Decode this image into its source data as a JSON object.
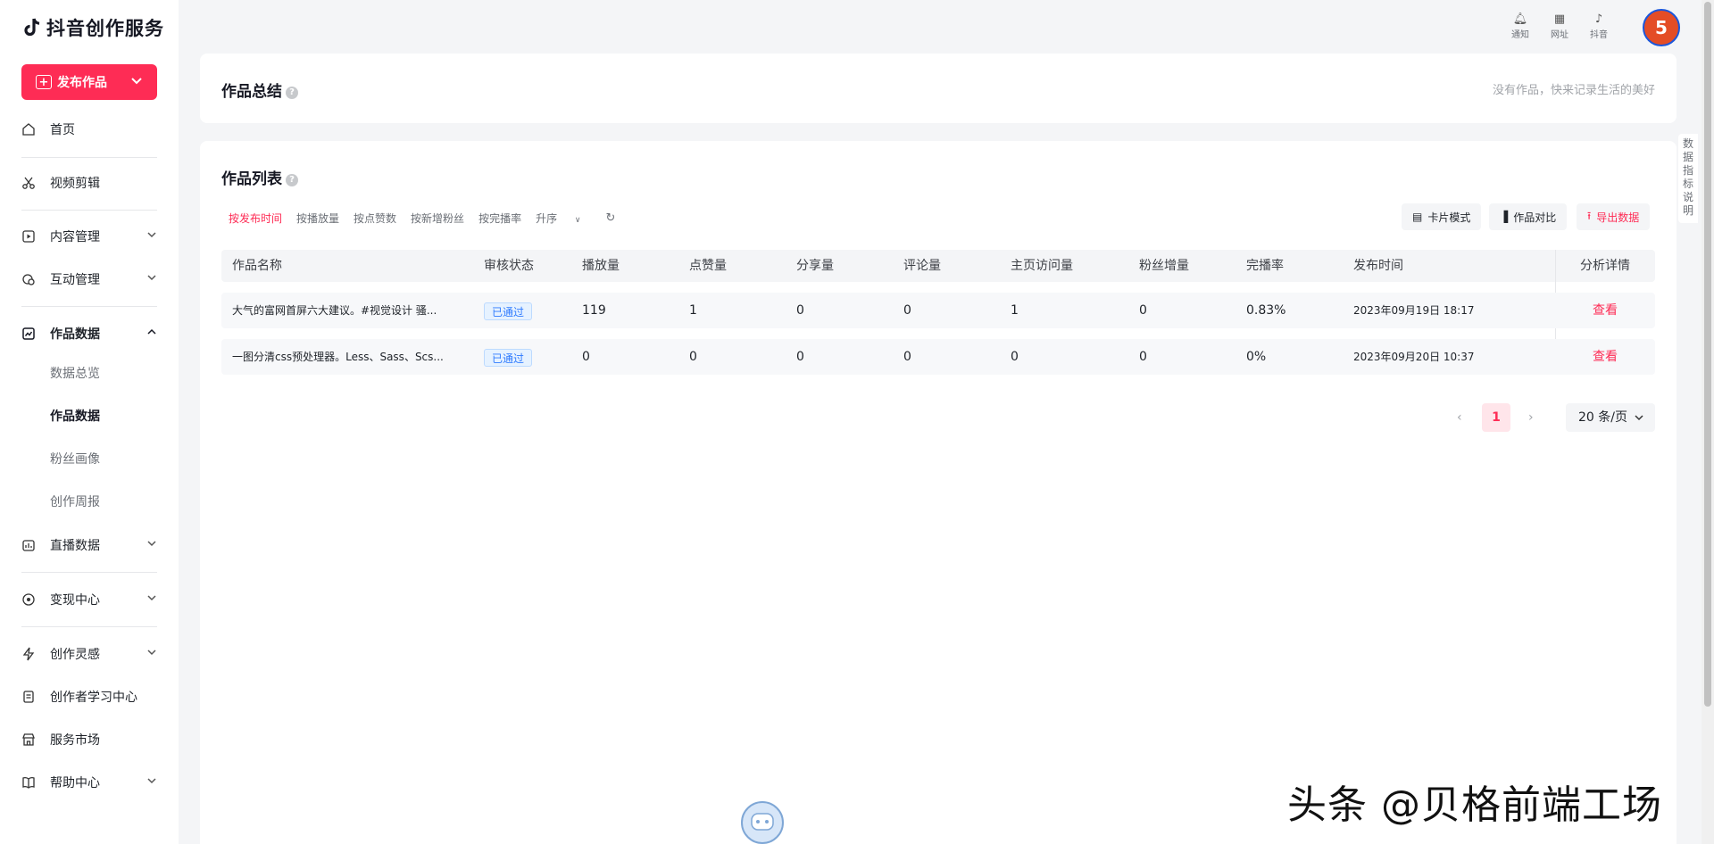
{
  "app": {
    "title": "抖音创作服务",
    "publish_label": "发布作品"
  },
  "sidebar": {
    "home": "首页",
    "video_edit": "视频剪辑",
    "content_mgmt": "内容管理",
    "interaction": "互动管理",
    "works_data": "作品数据",
    "sub": {
      "overview": "数据总览",
      "works": "作品数据",
      "fans": "粉丝画像",
      "weekly": "创作周报"
    },
    "live_data": "直播数据",
    "monetize": "变现中心",
    "inspiration": "创作灵感",
    "learning": "创作者学习中心",
    "market": "服务市场",
    "help": "帮助中心"
  },
  "topbar": {
    "notify": "通知",
    "site": "网址",
    "douyin": "抖音",
    "avatar_text": "5"
  },
  "summary": {
    "title": "作品总结",
    "hint": "没有作品，快来记录生活的美好"
  },
  "list": {
    "title": "作品列表",
    "sorts": [
      "按发布时间",
      "按播放量",
      "按点赞数",
      "按新增粉丝",
      "按完播率"
    ],
    "order": "升序",
    "card_mode": "卡片模式",
    "compare": "作品对比",
    "export": "导出数据",
    "columns": [
      "作品名称",
      "审核状态",
      "播放量",
      "点赞量",
      "分享量",
      "评论量",
      "主页访问量",
      "粉丝增量",
      "完播率",
      "发布时间",
      "分析详情"
    ],
    "rows": [
      {
        "name": "大气的富网首屏六大建议。#视觉设计 骚...",
        "status": "已通过",
        "play": "119",
        "like": "1",
        "share": "0",
        "comment": "0",
        "visit": "1",
        "fans": "0",
        "finish": "0.83%",
        "time": "2023年09月19日 18:17",
        "action": "查看"
      },
      {
        "name": "一图分清css预处理器。Less、Sass、Scs...",
        "status": "已通过",
        "play": "0",
        "like": "0",
        "share": "0",
        "comment": "0",
        "visit": "0",
        "fans": "0",
        "finish": "0%",
        "time": "2023年09月20日 10:37",
        "action": "查看"
      }
    ]
  },
  "pagination": {
    "current": "1",
    "size": "20 条/页"
  },
  "side_tab": "数据指标说明",
  "watermark": "头条 @贝格前端工场"
}
